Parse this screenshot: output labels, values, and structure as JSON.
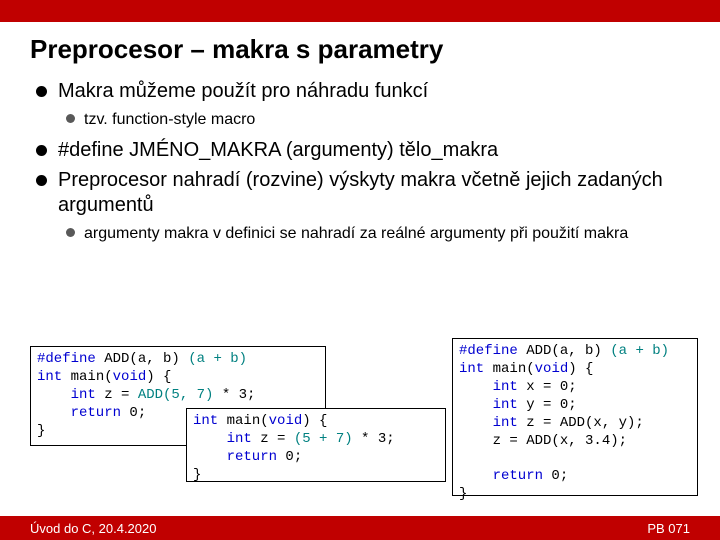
{
  "title": "Preprocesor – makra s parametry",
  "bullets": {
    "b1": "Makra můžeme použít pro náhradu funkcí",
    "b1s1": "tzv. function-style macro",
    "b2": "#define JMÉNO_MAKRA (argumenty) tělo_makra",
    "b3": "Preprocesor nahradí (rozvine) výskyty makra včetně jejich zadaných argumentů",
    "b3s1": "argumenty makra v definici se nahradí za reálné argumenty při použití makra"
  },
  "code1": {
    "l1a": "#define",
    "l1b": " ADD(a, b) ",
    "l1c": "(a + b)",
    "l2a": "int",
    "l2b": " main(",
    "l2c": "void",
    "l2d": ") {",
    "l3a": "    int",
    "l3b": " z = ",
    "l3c": "ADD(5, 7)",
    "l3d": " * 3;",
    "l4a": "    return",
    "l4b": " 0;",
    "l5": "}"
  },
  "code2": {
    "l1a": "int",
    "l1b": " main(",
    "l1c": "void",
    "l1d": ") {",
    "l2a": "    int",
    "l2b": " z = ",
    "l2c": "(5 + 7)",
    "l2d": " * 3;",
    "l3a": "    return",
    "l3b": " 0;",
    "l4": "}"
  },
  "code3": {
    "l1a": "#define",
    "l1b": " ADD(a, b) ",
    "l1c": "(a + b)",
    "l2a": "int",
    "l2b": " main(",
    "l2c": "void",
    "l2d": ") {",
    "l3a": "    int",
    "l3b": " x = 0;",
    "l4a": "    int",
    "l4b": " y = 0;",
    "l5a": "    int",
    "l5b": " z = ADD(x, y);",
    "l6": "    z = ADD(x, 3.4);",
    "blank": " ",
    "l7a": "    return",
    "l7b": " 0;",
    "l8": "}"
  },
  "footer": {
    "left": "Úvod do C, 20.4.2020",
    "right": "PB 071"
  }
}
